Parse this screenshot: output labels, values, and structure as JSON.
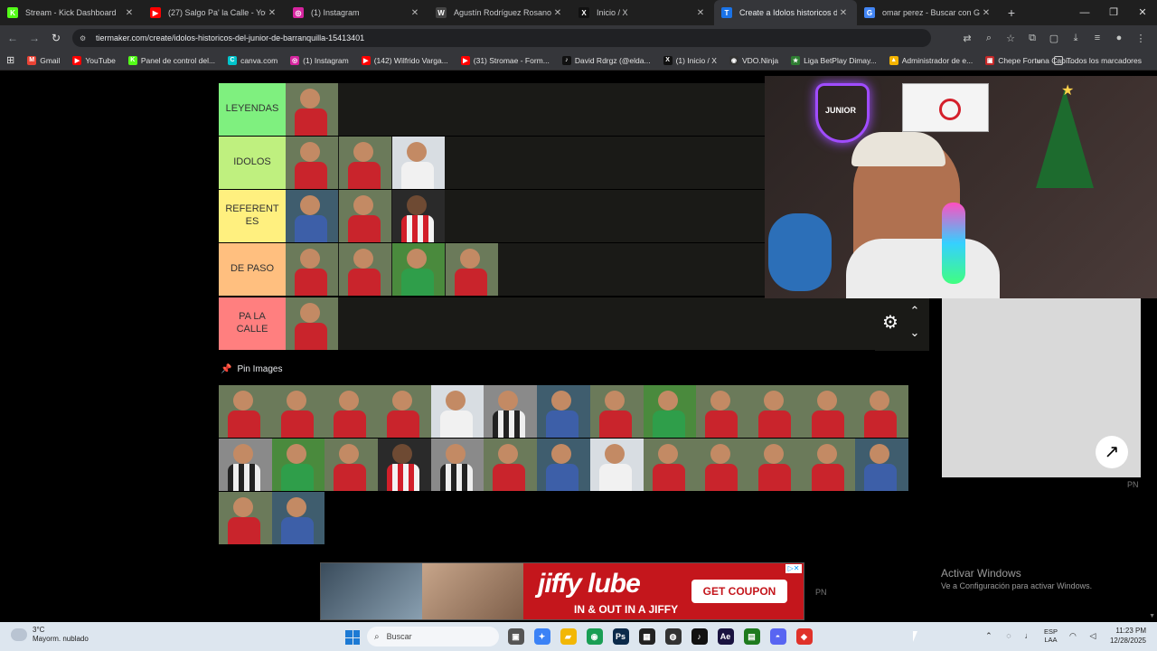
{
  "browser": {
    "tabs": [
      {
        "title": "Stream - Kick Dashboard",
        "icon": "K",
        "color": "#53fc18",
        "active": false
      },
      {
        "title": "(27) Salgo Pa' la Calle - YouTube",
        "icon": "▶",
        "color": "#ff0000",
        "active": false
      },
      {
        "title": "(1) Instagram",
        "icon": "◎",
        "color": "#d6249f",
        "active": false
      },
      {
        "title": "Agustín Rodríguez Rosano - Wi",
        "icon": "W",
        "color": "#444444",
        "active": false
      },
      {
        "title": "Inicio / X",
        "icon": "X",
        "color": "#111111",
        "active": false
      },
      {
        "title": "Create a Idolos historicos del Ju",
        "icon": "T",
        "color": "#1a73e8",
        "active": true
      },
      {
        "title": "omar perez - Buscar con Google",
        "icon": "G",
        "color": "#4285f4",
        "active": false
      }
    ],
    "new_tab": "+",
    "url": "tiermaker.com/create/idolos-historicos-del-junior-de-barranquilla-15413401",
    "bookmarks": [
      {
        "label": "Gmail",
        "icon": "M",
        "color": "#ea4335"
      },
      {
        "label": "YouTube",
        "icon": "▶",
        "color": "#ff0000"
      },
      {
        "label": "Panel de control del...",
        "icon": "K",
        "color": "#53fc18"
      },
      {
        "label": "canva.com",
        "icon": "C",
        "color": "#00c4cc"
      },
      {
        "label": "(1) Instagram",
        "icon": "◎",
        "color": "#d6249f"
      },
      {
        "label": "(142) Wilfrido Varga...",
        "icon": "▶",
        "color": "#ff0000"
      },
      {
        "label": "(31) Stromae - Form...",
        "icon": "▶",
        "color": "#ff0000"
      },
      {
        "label": "David Rdrgz (@elda...",
        "icon": "♪",
        "color": "#111111"
      },
      {
        "label": "(1) Inicio / X",
        "icon": "X",
        "color": "#111111"
      },
      {
        "label": "VDO.Ninja",
        "icon": "◉",
        "color": "#333333"
      },
      {
        "label": "Liga BetPlay Dimay...",
        "icon": "★",
        "color": "#2e7d32"
      },
      {
        "label": "Administrador de e...",
        "icon": "▲",
        "color": "#f4b400"
      },
      {
        "label": "Chepe Fortuna Capí...",
        "icon": "▣",
        "color": "#c62828"
      }
    ],
    "bookmarks_overflow": "»",
    "all_bookmarks": "Todos los marcadores"
  },
  "tiers": [
    {
      "label": "LEYENDAS",
      "color": "#7ff07f",
      "items": [
        "red"
      ]
    },
    {
      "label": "IDOLOS",
      "color": "#bff07f",
      "items": [
        "red",
        "red",
        "white"
      ]
    },
    {
      "label": "REFERENT ES",
      "color": "#fff07f",
      "items": [
        "blue",
        "red",
        "dark"
      ]
    },
    {
      "label": "DE PASO",
      "color": "#ffbf7f",
      "items": [
        "red",
        "red",
        "green",
        "red"
      ]
    },
    {
      "label": "PA LA CALLE",
      "color": "#ff7f7f",
      "items": [
        "red"
      ]
    }
  ],
  "pin_images": {
    "label": "Pin Images",
    "items": [
      "red",
      "red",
      "red",
      "red",
      "white",
      "bw",
      "blue",
      "red",
      "green",
      "red",
      "red",
      "red",
      "red",
      "bw",
      "green",
      "red",
      "dark",
      "bw",
      "red",
      "blue",
      "white",
      "red",
      "red",
      "red",
      "red",
      "blue",
      "red",
      "blue"
    ]
  },
  "side_panel": {
    "pn_label": "PN"
  },
  "ad": {
    "brand": "jiffy lube",
    "tagline": "IN & OUT IN A JIFFY",
    "cta": "GET COUPON",
    "pn_label": "PN"
  },
  "windows_activation": {
    "title": "Activar Windows",
    "subtitle": "Ve a Configuración para activar Windows."
  },
  "taskbar": {
    "weather_temp": "3°C",
    "weather_desc": "Mayorm. nublado",
    "search_placeholder": "Buscar",
    "apps": [
      {
        "icon": "▣",
        "color": "#555555"
      },
      {
        "icon": "✦",
        "color": "#3b82f6"
      },
      {
        "icon": "▰",
        "color": "#f2b705"
      },
      {
        "icon": "◉",
        "color": "#1a9e54"
      },
      {
        "icon": "Ps",
        "color": "#0b2a4a"
      },
      {
        "icon": "▦",
        "color": "#222222"
      },
      {
        "icon": "◍",
        "color": "#333333"
      },
      {
        "icon": "♪",
        "color": "#111111"
      },
      {
        "icon": "Ae",
        "color": "#1a1340"
      },
      {
        "icon": "▤",
        "color": "#1e7a1e"
      },
      {
        "icon": "◓",
        "color": "#5865f2"
      },
      {
        "icon": "◆",
        "color": "#e0322a"
      }
    ],
    "lang_top": "ESP",
    "lang_bottom": "LAA",
    "time": "11:23 PM",
    "date": "12/28/2025"
  }
}
